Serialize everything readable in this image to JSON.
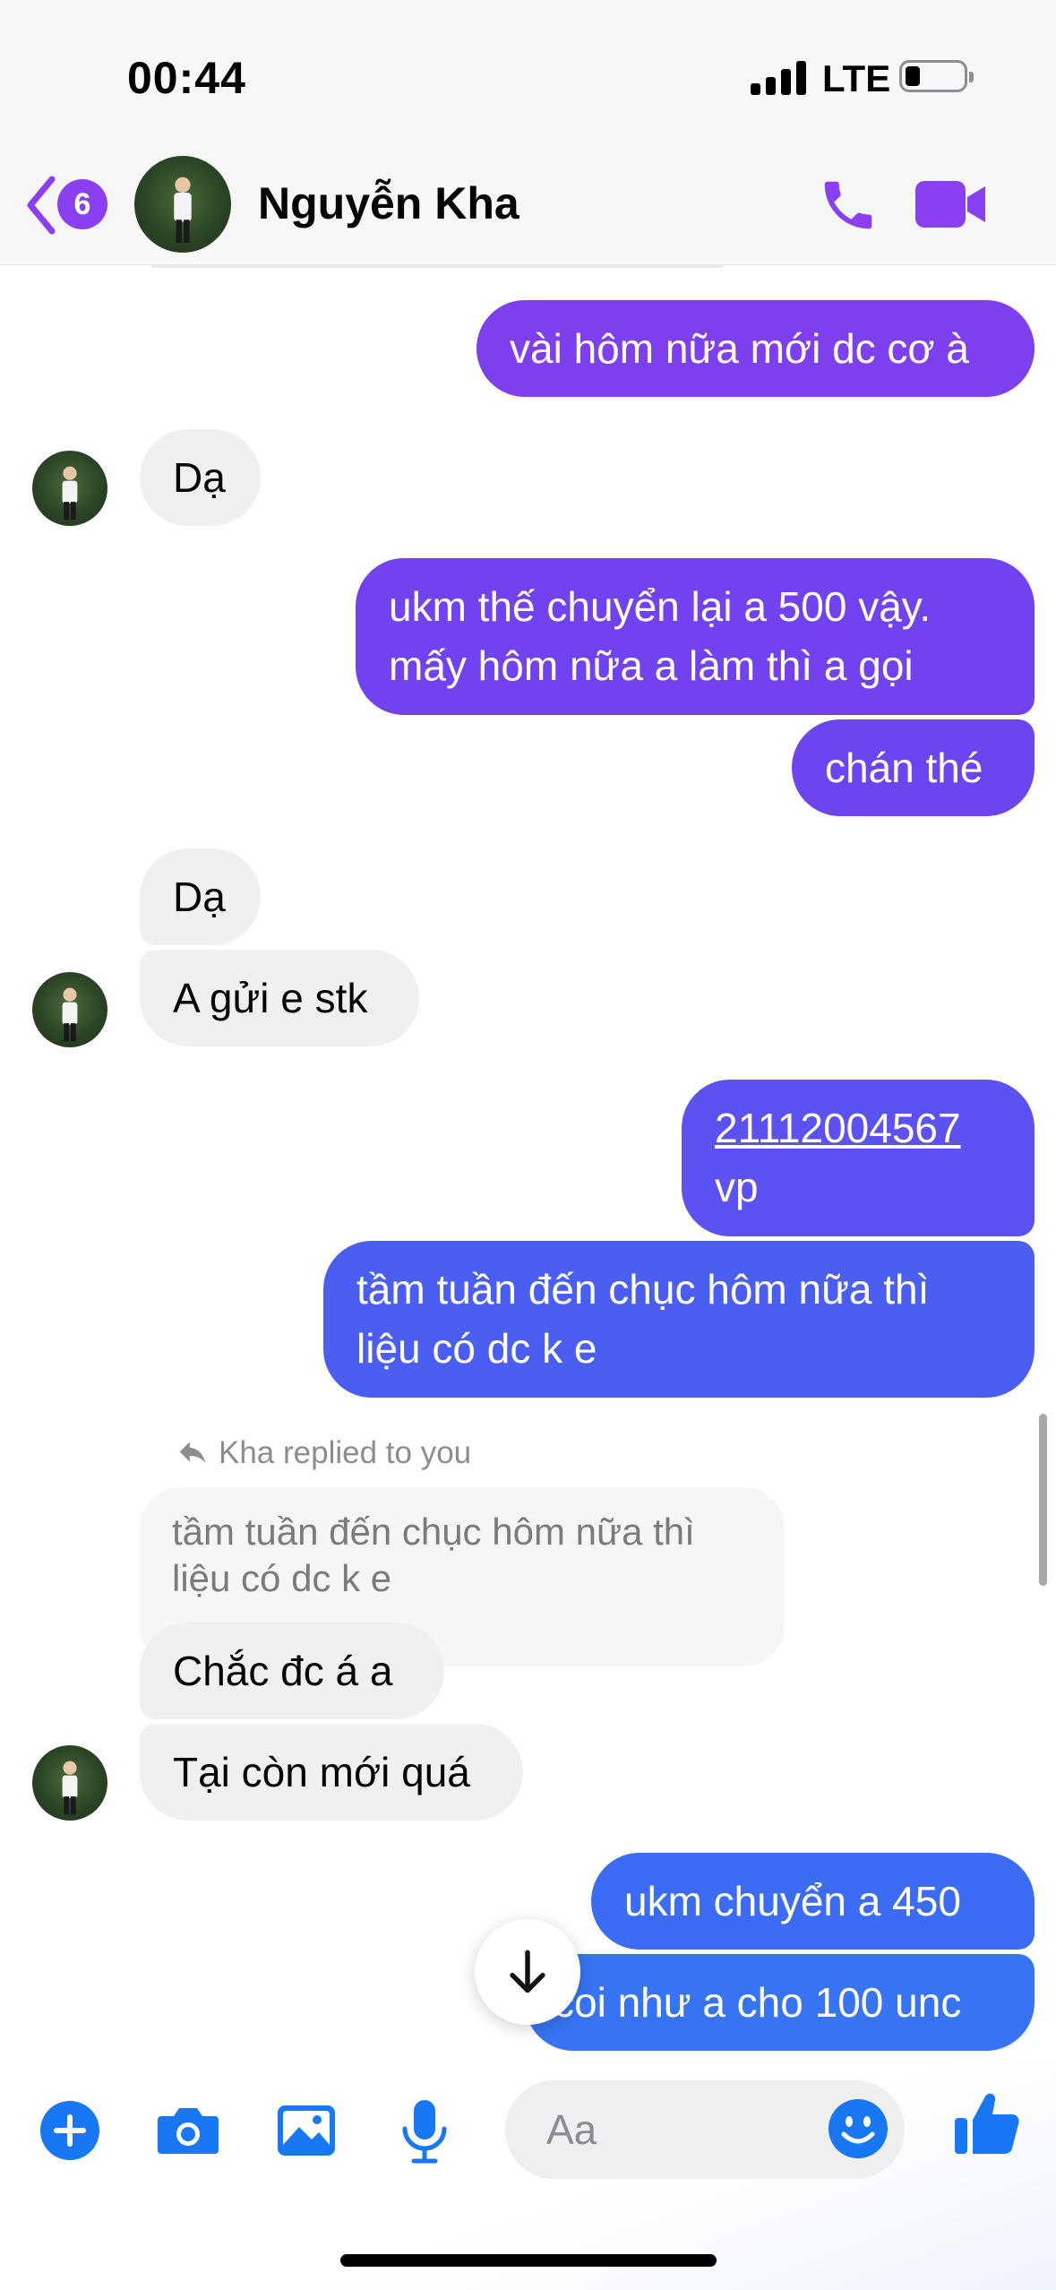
{
  "status_bar": {
    "time": "00:44",
    "network": "LTE"
  },
  "header": {
    "unread_count": "6",
    "contact_name": "Nguyễn Kha"
  },
  "messages": [
    {
      "lines": [
        "vài hôm nữa mới dc cơ à"
      ]
    },
    {
      "lines": [
        "Dạ"
      ]
    },
    {
      "lines": [
        "ukm thế chuyển lại a 500 vậy.",
        "mấy hôm nữa a làm thì a gọi"
      ]
    },
    {
      "lines": [
        "chán thé"
      ]
    },
    {
      "lines": [
        "Dạ"
      ]
    },
    {
      "lines": [
        "A gửi e stk"
      ]
    },
    {
      "lines": [
        "21112004567",
        "vp"
      ]
    },
    {
      "lines": [
        "tầm tuần đến chục hôm nữa thì",
        "liệu có dc k e"
      ]
    },
    {
      "lines": [
        "Chắc đc á a"
      ]
    },
    {
      "lines": [
        "Tại còn mới quá"
      ]
    },
    {
      "lines": [
        "ukm chuyển a 450"
      ]
    },
    {
      "lines": [
        "coi như a cho 100 unc"
      ]
    }
  ],
  "reply": {
    "note": "Kha replied to you",
    "quoted_lines": [
      "tầm tuần đến chục hôm nữa thì",
      "liệu có dc k e"
    ]
  },
  "composer": {
    "placeholder": "Aa"
  },
  "colors": {
    "accent": "#7b3fe4",
    "brand_blue": "#1877f2",
    "incoming_bubble": "#f0f0f0"
  },
  "icons": {
    "back": "chevron-left-icon",
    "call": "phone-icon",
    "video": "video-camera-icon",
    "plus": "plus-circle-icon",
    "camera": "camera-icon",
    "gallery": "image-icon",
    "mic": "microphone-icon",
    "emoji": "smiley-icon",
    "like": "thumbs-up-icon",
    "scroll": "arrow-down-icon"
  }
}
